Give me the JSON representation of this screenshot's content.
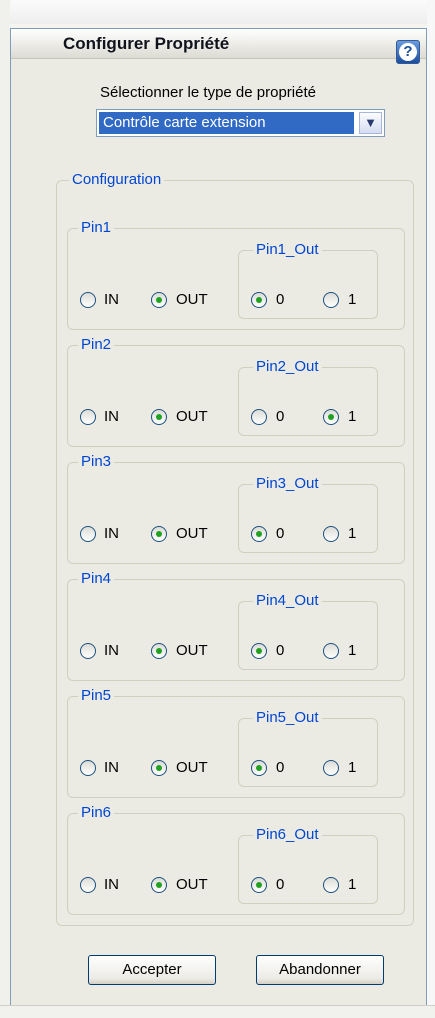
{
  "window": {
    "title": "Configurer Propriété"
  },
  "selector": {
    "label": "Sélectionner le type de propriété",
    "value": "Contrôle carte extension"
  },
  "config": {
    "title": "Configuration",
    "in_label": "IN",
    "out_label": "OUT",
    "zero_label": "0",
    "one_label": "1",
    "pins": [
      {
        "name": "Pin1",
        "out_group": "Pin1_Out",
        "mode": "OUT",
        "value": "0"
      },
      {
        "name": "Pin2",
        "out_group": "Pin2_Out",
        "mode": "OUT",
        "value": "1"
      },
      {
        "name": "Pin3",
        "out_group": "Pin3_Out",
        "mode": "OUT",
        "value": "0"
      },
      {
        "name": "Pin4",
        "out_group": "Pin4_Out",
        "mode": "OUT",
        "value": "0"
      },
      {
        "name": "Pin5",
        "out_group": "Pin5_Out",
        "mode": "OUT",
        "value": "0"
      },
      {
        "name": "Pin6",
        "out_group": "Pin6_Out",
        "mode": "OUT",
        "value": "0"
      }
    ]
  },
  "buttons": {
    "accept": "Accepter",
    "cancel": "Abandonner"
  },
  "colors": {
    "group_title": "#0046d5",
    "selection": "#316ac5",
    "radio_dot": "#21a121"
  },
  "icons": {
    "help": "question-mark"
  }
}
